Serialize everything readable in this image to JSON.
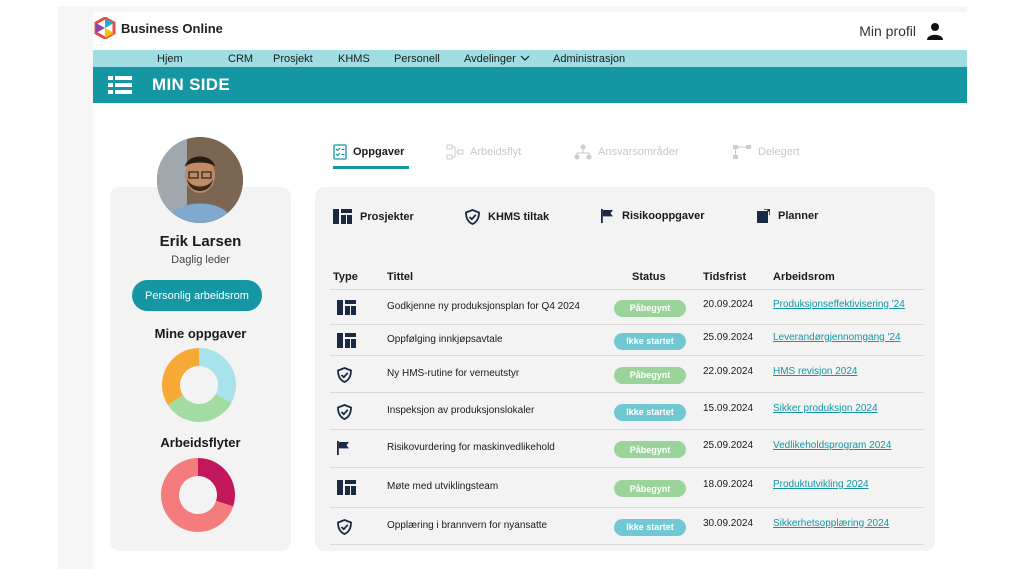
{
  "header": {
    "brand": "Business Online",
    "profile_label": "Min profil"
  },
  "nav": {
    "items": [
      "Hjem",
      "CRM",
      "Prosjekt",
      "KHMS",
      "Personell",
      "Avdelinger",
      "Administrasjon"
    ]
  },
  "titlebar": {
    "title": "MIN SIDE"
  },
  "user": {
    "name": "Erik Larsen",
    "role": "Daglig leder",
    "personal_button": "Personlig arbeidsrom"
  },
  "sections": {
    "tasks": "Mine oppgaver",
    "workflows": "Arbeidsflyter"
  },
  "tabs": [
    "Oppgaver",
    "Arbeidsflyt",
    "Ansvarsområder",
    "Delegert"
  ],
  "filters": [
    "Prosjekter",
    "KHMS tiltak",
    "Risikooppgaver",
    "Planner"
  ],
  "table": {
    "headers": [
      "Type",
      "Tittel",
      "Status",
      "Tidsfrist",
      "Arbeidsrom"
    ],
    "rows": [
      {
        "type": "project-icon",
        "title": "Godkjenne ny produksjonsplan for Q4 2024",
        "status": "Påbegynt",
        "deadline": "20.09.2024",
        "workspace": "Produksjonseffektivisering '24"
      },
      {
        "type": "project-icon",
        "title": "Oppfølging innkjøpsavtale",
        "status": "Ikke startet",
        "deadline": "25.09.2024",
        "workspace": "Leverandørgjennomgang '24"
      },
      {
        "type": "shield-icon",
        "title": "Ny HMS-rutine for verneutstyr",
        "status": "Påbegynt",
        "deadline": "22.09.2024",
        "workspace": "HMS revisjon 2024"
      },
      {
        "type": "shield-icon",
        "title": "Inspeksjon av produksjonslokaler",
        "status": "Ikke startet",
        "deadline": "15.09.2024",
        "workspace": "Sikker produksjon 2024"
      },
      {
        "type": "flag-icon",
        "title": "Risikovurdering for maskinvedlikehold",
        "status": "Påbegynt",
        "deadline": "25.09.2024",
        "workspace": "Vedlikeholdsprogram 2024"
      },
      {
        "type": "project-icon",
        "title": "Møte med utviklingsteam",
        "status": "Påbegynt",
        "deadline": "18.09.2024",
        "workspace": "Produktutvikling 2024"
      },
      {
        "type": "shield-icon",
        "title": "Opplæring i brannvern for nyansatte",
        "status": "Ikke startet",
        "deadline": "30.09.2024",
        "workspace": "Sikkerhetsopplæring 2024"
      }
    ]
  },
  "colors": {
    "accent": "#1496a3",
    "nav_bg": "#9fdde3",
    "in_progress": "#9bd49a",
    "not_started": "#6fc8d2"
  },
  "charts": {
    "tasks_donut": [
      {
        "value": 0.33,
        "color": "#a8e3ec"
      },
      {
        "value": 0.33,
        "color": "#a3dca0"
      },
      {
        "value": 0.34,
        "color": "#f7a935"
      }
    ],
    "workflows_donut": [
      {
        "value": 0.3,
        "color": "#c2185b"
      },
      {
        "value": 0.7,
        "color": "#f47c7c"
      }
    ]
  }
}
